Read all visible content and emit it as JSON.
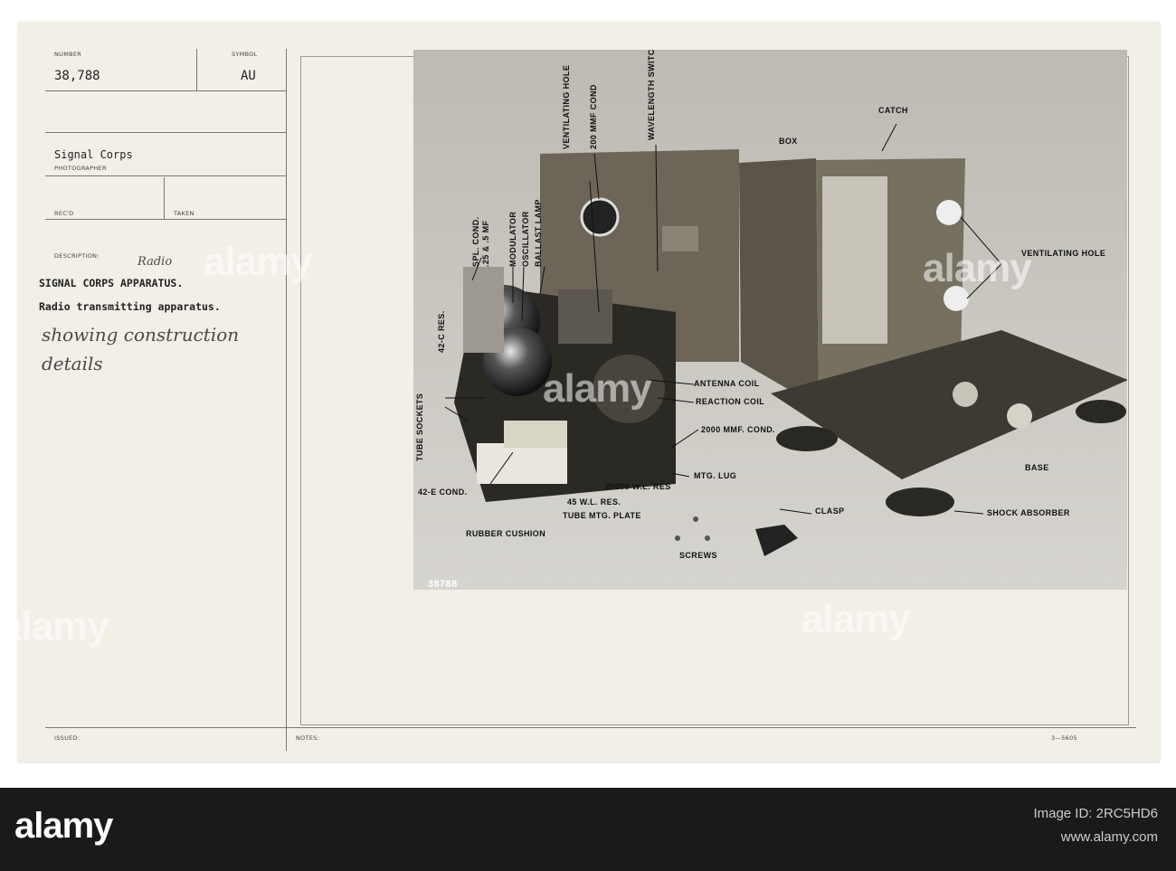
{
  "card": {
    "number_label": "NUMBER",
    "number_value": "38,788",
    "symbol_label": "SYMBOL",
    "symbol_value": "AU",
    "photographer_value": "Signal Corps",
    "photographer_label": "PHOTOGRAPHER",
    "recd_label": "REC'D",
    "taken_label": "TAKEN",
    "description_label": "DESCRIPTION:",
    "handwritten_insert": "Radio",
    "description_line1": "SIGNAL CORPS APPARATUS.",
    "description_line2": "Radio transmitting apparatus.",
    "handwritten_line1": "showing construction",
    "handwritten_line2": "details",
    "issued_label": "ISSUED:",
    "notes_label": "NOTES:",
    "form_number": "3—5605"
  },
  "photo": {
    "labels": {
      "spl_cond": "SPL. COND.",
      "spl_cond_value": ".25 & .5 MF",
      "modulator": "MODULATOR",
      "oscillator": "OSCILLATOR",
      "ballast_lamp": "BALLAST LAMP",
      "ventilating_hole_top": "VENTILATING HOLE",
      "cond_200": "200 MMF COND",
      "wavelength_switch": "WAVELENGTH SWITCH",
      "box": "BOX",
      "catch": "CATCH",
      "ventilating_hole_right": "VENTILATING HOLE",
      "res_42c": "42-C RES.",
      "tube_sockets": "TUBE SOCKETS",
      "antenna_coil": "ANTENNA COIL",
      "reaction_coil": "REACTION COIL",
      "cond_2000": "2000 MMF. COND.",
      "mtg_lug": "MTG. LUG",
      "res_20000": "20000 W.L. RES",
      "res_45": "45 W.L. RES.",
      "tube_mtg_plate": "TUBE MTG. PLATE",
      "cond_42e": "42-E COND.",
      "rubber_cushion": "RUBBER CUSHION",
      "screws": "SCREWS",
      "clasp": "CLASP",
      "base": "BASE",
      "shock_absorber": "SHOCK ABSORBER",
      "negative_number": "38788"
    }
  },
  "watermark": "alamy",
  "footer": {
    "logo": "alamy",
    "image_id": "Image ID: 2RC5HD6",
    "url": "www.alamy.com"
  }
}
